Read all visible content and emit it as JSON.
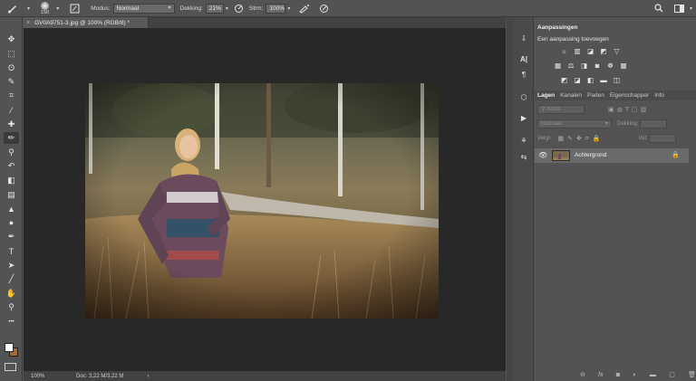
{
  "options_bar": {
    "brush_size": "150",
    "mode_label": "Modus:",
    "mode_value": "Normaal",
    "opacity_label": "Dekking:",
    "opacity_value": "21%",
    "flow_label": "Strm:",
    "flow_value": "100%"
  },
  "document": {
    "tab_title": "GV0A9751-3.jpg @ 100% (RGB/8) *",
    "close_glyph": "×",
    "zoom": "100%",
    "doc_info": "Doc: 3,22 M/3,22 M",
    "status_arrow": "›"
  },
  "toolbar": {
    "tools": [
      {
        "name": "move-tool",
        "glyph": "✥"
      },
      {
        "name": "marquee-tool",
        "glyph": "⬚"
      },
      {
        "name": "lasso-tool",
        "glyph": "ʘ"
      },
      {
        "name": "quick-select-tool",
        "glyph": "✎"
      },
      {
        "name": "crop-tool",
        "glyph": "⌗"
      },
      {
        "name": "eyedropper-tool",
        "glyph": "⁄"
      },
      {
        "name": "healing-tool",
        "glyph": "✚"
      },
      {
        "name": "brush-tool",
        "glyph": "✏"
      },
      {
        "name": "stamp-tool",
        "glyph": "⚲"
      },
      {
        "name": "history-brush-tool",
        "glyph": "↶"
      },
      {
        "name": "eraser-tool",
        "glyph": "◧"
      },
      {
        "name": "gradient-tool",
        "glyph": "▤"
      },
      {
        "name": "blur-tool",
        "glyph": "▲"
      },
      {
        "name": "dodge-tool",
        "glyph": "●"
      },
      {
        "name": "pen-tool",
        "glyph": "✒"
      },
      {
        "name": "type-tool",
        "glyph": "T"
      },
      {
        "name": "path-select-tool",
        "glyph": "➤"
      },
      {
        "name": "line-tool",
        "glyph": "╱"
      },
      {
        "name": "hand-tool",
        "glyph": "✋"
      },
      {
        "name": "zoom-tool",
        "glyph": "⚲"
      },
      {
        "name": "more-tools",
        "glyph": "•••"
      }
    ]
  },
  "adjustments": {
    "tab_label": "Aanpassingen",
    "subtitle": "Een aanpassing toevoegen",
    "row1": [
      "☼",
      "▥",
      "◪",
      "◩",
      "▽"
    ],
    "row2": [
      "▦",
      "⚖",
      "◨",
      "◙",
      "❁",
      "▦"
    ],
    "row3": [
      "◩",
      "◪",
      "◧",
      "▬",
      "◫"
    ]
  },
  "layers": {
    "tabs": [
      "Lagen",
      "Kanalen",
      "Paden",
      "Eigenschapper",
      "Info"
    ],
    "filter_placeholder": "Soort",
    "blend_mode": "Normaal",
    "opacity_label": "Dekking:",
    "lock_label": "Vergr.:",
    "fill_label": "Vul:",
    "layer_name": "Achtergrond",
    "visibility_glyph": "👁",
    "lock_glyph": "🔒",
    "bottom_icons": [
      "⊖",
      "fx",
      "◙",
      "◐",
      "▬",
      "▢",
      "🗑"
    ]
  },
  "colors": {
    "ui_bg": "#535353",
    "canvas_bg": "#282828",
    "selected_layer": "#6a6a6a"
  }
}
